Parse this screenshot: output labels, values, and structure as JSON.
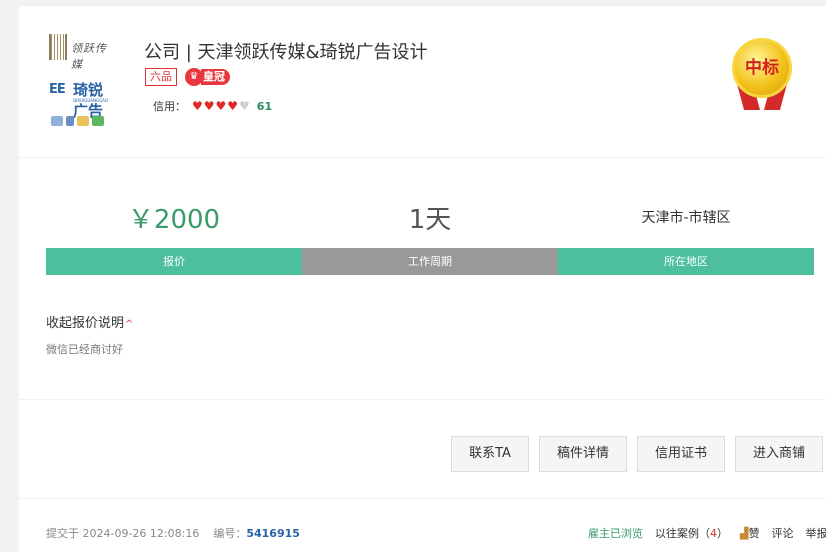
{
  "company": {
    "title": "公司 | 天津领跃传媒&琦锐广告设计",
    "rank_tag": "六品",
    "crown_label": "皇冠",
    "crown_icon": "crown-icon",
    "credit_label": "信用：",
    "credit_hearts_on": "♥♥♥♥",
    "credit_hearts_off": "♥",
    "credit_score": "61"
  },
  "logo": {
    "line1": "领跃传媒",
    "mark": "EE",
    "line2": "琦锐广告",
    "line2_en": "QIRUIGUANGGAO"
  },
  "medal": {
    "text": "中标",
    "color": "#f2c21a"
  },
  "stats": {
    "price": "￥2000",
    "period": "1天",
    "region": "天津市-市辖区",
    "price_label": "报价",
    "period_label": "工作周期",
    "region_label": "所在地区"
  },
  "explain": {
    "toggle": "收起报价说明",
    "caret": "^",
    "text": "微信已经商讨好"
  },
  "actions": {
    "contact": "联系TA",
    "draft": "稿件详情",
    "cert": "信用证书",
    "shop": "进入商铺"
  },
  "footer": {
    "submitted_prefix": "提交于",
    "submitted_time": "2024-09-26 12:08:16",
    "id_prefix": "编号：",
    "id": "5416915",
    "viewed": "雇主已浏览",
    "cases_prefix": "以往案例（",
    "cases_count": "4",
    "cases_suffix": "）",
    "like": "赞",
    "comment": "评论",
    "report": "举报"
  },
  "colors": {
    "accent_green": "#4dbf9f",
    "price_green": "#3a9a6a",
    "red": "#e03030"
  }
}
